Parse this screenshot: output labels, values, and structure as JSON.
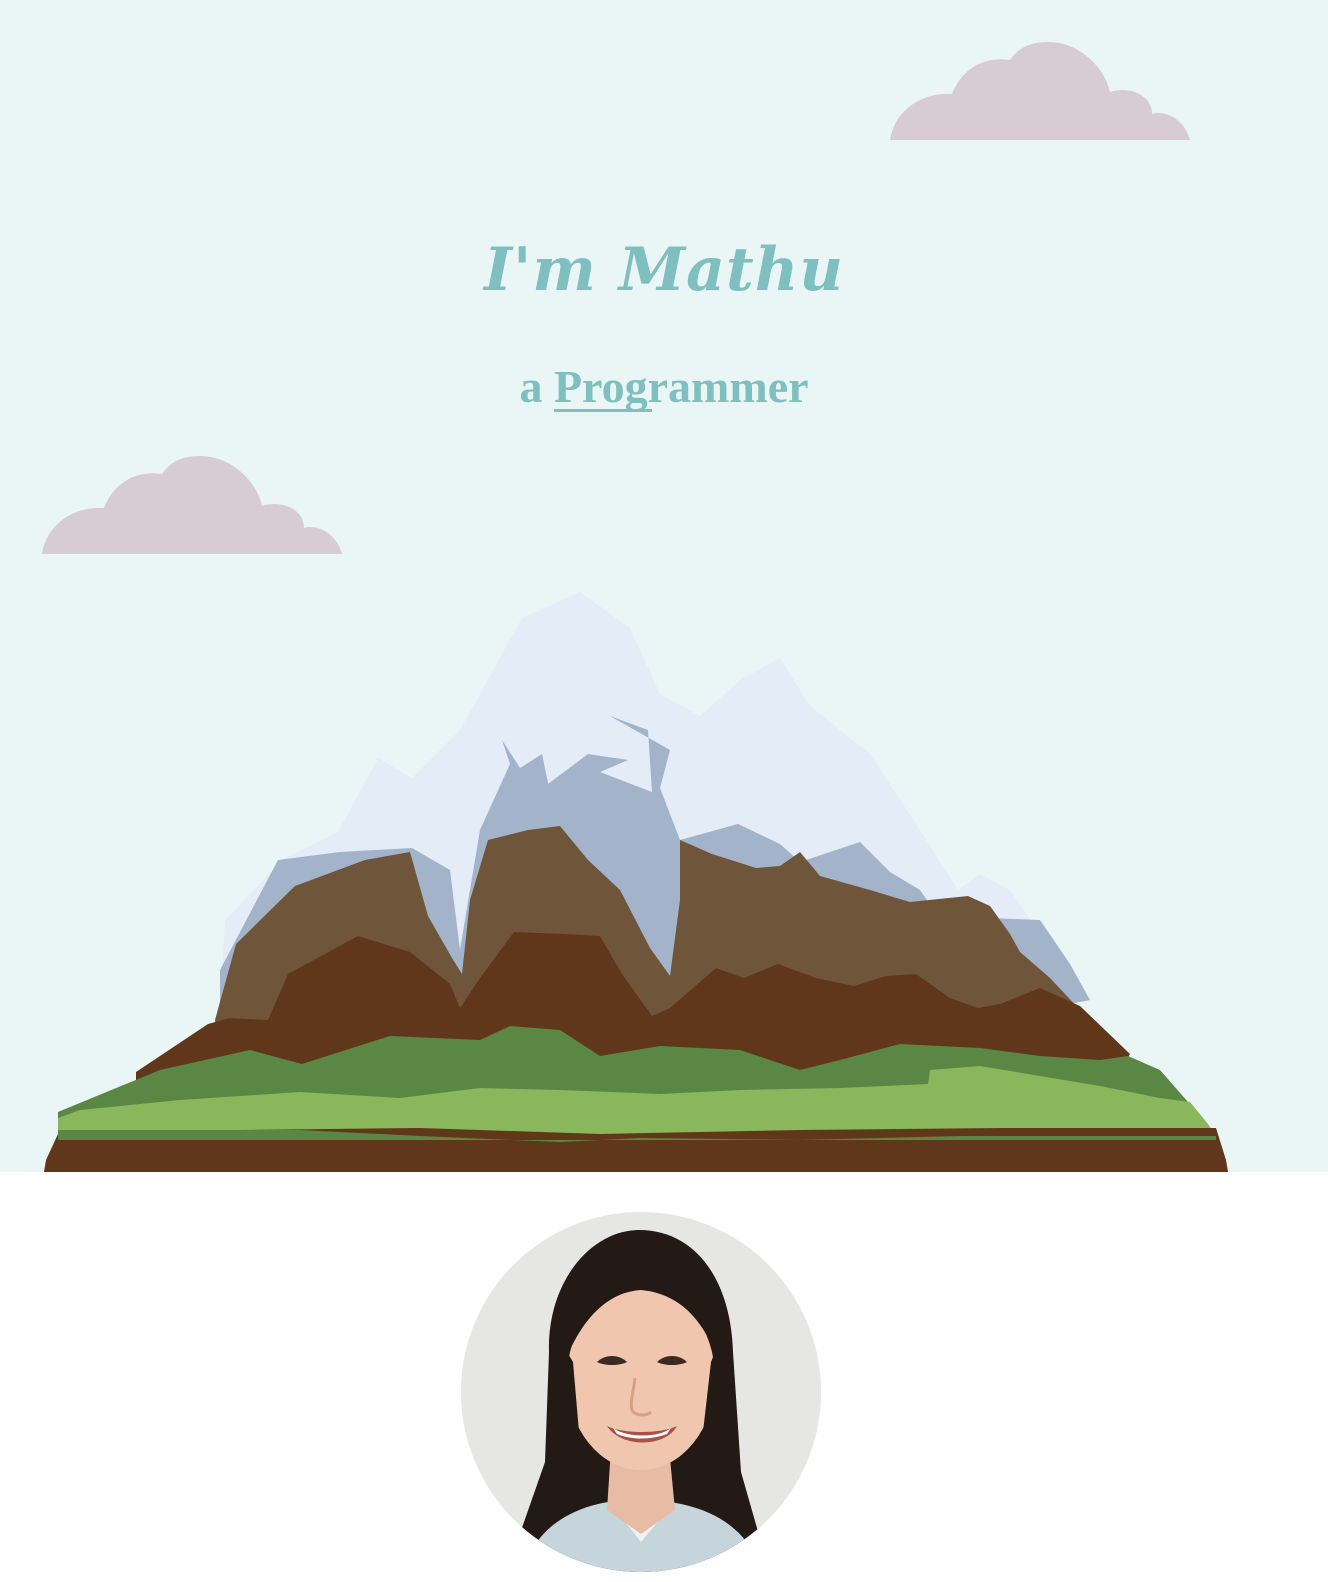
{
  "hero": {
    "title": "I'm Mathu",
    "subtitle_prefix": "a",
    "subtitle_typed": "Programmer"
  },
  "icons": {
    "cloud": "cloud-icon",
    "mountain": "mountain-illustration",
    "avatar": "profile-photo"
  },
  "colors": {
    "sky": "#eaf6f6",
    "accent": "#7fbfbf",
    "cloud": "#d8ccd4",
    "snow": "#e3ecf7",
    "snow_shadow": "#a3b3c9",
    "rock_light": "#6f563a",
    "rock_dark": "#61371b",
    "grass_dark": "#5a8744",
    "grass_light": "#8ab65c"
  }
}
